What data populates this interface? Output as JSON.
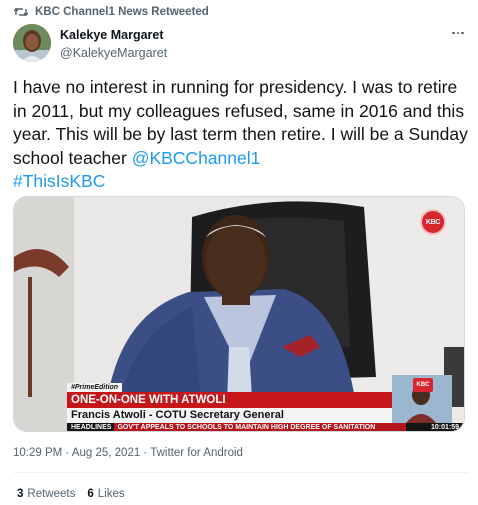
{
  "retweet": {
    "label": "KBC Channel1 News Retweeted",
    "icon": "retweet-icon"
  },
  "author": {
    "name": "Kalekye Margaret",
    "handle": "@KalekyeMargaret"
  },
  "tweet": {
    "text": "I have no interest in running for presidency. I was to retire in 2011, but my colleagues refused, same in 2016 and this year. This will be by last term then retire.  I will be a Sunday school teacher ",
    "mention": "@KBCChannel1",
    "hashtag": "#ThisIsKBC"
  },
  "media": {
    "logo": "KBC",
    "edition_tag": "#PrimeEdition",
    "lower_third_title": "ONE-ON-ONE WITH ATWOLI",
    "lower_third_name": "Francis Atwoli - COTU Secretary General",
    "ticker_label": "HEADLINES",
    "ticker_text": "GOV'T APPEALS TO SCHOOLS TO MAINTAIN HIGH DEGREE OF SANITATION",
    "ticker_time": "10:01:59",
    "inset_logo": "KBC"
  },
  "meta": {
    "timestamp": "10:29 PM · Aug 25, 2021 · Twitter for Android"
  },
  "stats": {
    "retweets_count": "3",
    "retweets_label": "Retweets",
    "likes_count": "6",
    "likes_label": "Likes"
  },
  "colors": {
    "link": "#1d9bf0",
    "secondary_text": "#536471",
    "primary_text": "#0f1419",
    "broadcast_red": "#c5161a"
  }
}
